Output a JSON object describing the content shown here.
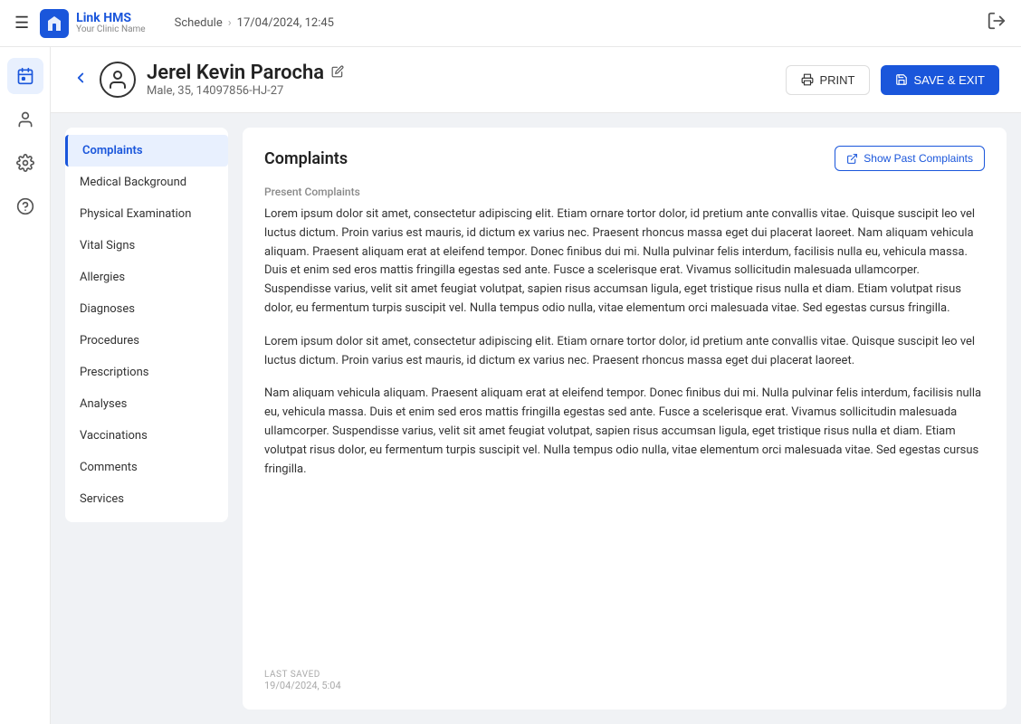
{
  "topNav": {
    "hamburger": "☰",
    "logoName": "Link HMS",
    "logoSub": "Your Clinic Name",
    "breadcrumb": {
      "schedule": "Schedule",
      "separator": "›",
      "datetime": "17/04/2024, 12:45"
    }
  },
  "iconSidebar": {
    "items": [
      {
        "name": "calendar-icon",
        "icon": "📅",
        "active": true
      },
      {
        "name": "user-icon",
        "icon": "👤",
        "active": false
      },
      {
        "name": "settings-icon",
        "icon": "⚙️",
        "active": false
      },
      {
        "name": "help-icon",
        "icon": "❓",
        "active": false
      }
    ]
  },
  "patient": {
    "name": "Jerel Kevin Parocha",
    "meta": "Male, 35, 14097856-HJ-27",
    "printLabel": "PRINT",
    "saveLabel": "SAVE & EXIT"
  },
  "leftNav": {
    "items": [
      {
        "label": "Complaints",
        "active": true
      },
      {
        "label": "Medical Background",
        "active": false
      },
      {
        "label": "Physical Examination",
        "active": false
      },
      {
        "label": "Vital Signs",
        "active": false
      },
      {
        "label": "Allergies",
        "active": false
      },
      {
        "label": "Diagnoses",
        "active": false
      },
      {
        "label": "Procedures",
        "active": false
      },
      {
        "label": "Prescriptions",
        "active": false
      },
      {
        "label": "Analyses",
        "active": false
      },
      {
        "label": "Vaccinations",
        "active": false
      },
      {
        "label": "Comments",
        "active": false
      },
      {
        "label": "Services",
        "active": false
      }
    ]
  },
  "panel": {
    "title": "Complaints",
    "showPastBtn": "Show Past Complaints",
    "sectionLabel": "Present Complaints",
    "complaints": [
      "Lorem ipsum dolor sit amet, consectetur adipiscing elit. Etiam ornare tortor dolor, id pretium ante convallis vitae. Quisque suscipit leo vel luctus dictum. Proin varius est mauris, id dictum ex varius nec. Praesent rhoncus massa eget dui placerat laoreet. Nam aliquam vehicula aliquam. Praesent aliquam erat at eleifend tempor. Donec finibus dui mi. Nulla pulvinar felis interdum, facilisis nulla eu, vehicula massa. Duis et enim sed eros mattis fringilla egestas sed ante. Fusce a scelerisque erat. Vivamus sollicitudin malesuada ullamcorper. Suspendisse varius, velit sit amet feugiat volutpat, sapien risus accumsan ligula, eget tristique risus nulla et diam. Etiam volutpat risus dolor, eu fermentum turpis suscipit vel. Nulla tempus odio nulla, vitae elementum orci malesuada vitae. Sed egestas cursus fringilla.",
      "Lorem ipsum dolor sit amet, consectetur adipiscing elit. Etiam ornare tortor dolor, id pretium ante convallis vitae. Quisque suscipit leo vel luctus dictum. Proin varius est mauris, id dictum ex varius nec. Praesent rhoncus massa eget dui placerat laoreet.",
      "Nam aliquam vehicula aliquam. Praesent aliquam erat at eleifend tempor. Donec finibus dui mi. Nulla pulvinar felis interdum, facilisis nulla eu, vehicula massa. Duis et enim sed eros mattis fringilla egestas sed ante. Fusce a scelerisque erat. Vivamus sollicitudin malesuada ullamcorper. Suspendisse varius, velit sit amet feugiat volutpat, sapien risus accumsan ligula, eget tristique risus nulla et diam. Etiam volutpat risus dolor, eu fermentum turpis suscipit vel. Nulla tempus odio nulla, vitae elementum orci malesuada vitae. Sed egestas cursus fringilla."
    ]
  },
  "footer": {
    "lastSavedLabel": "LAST SAVED",
    "lastSavedTime": "19/04/2024, 5:04"
  }
}
